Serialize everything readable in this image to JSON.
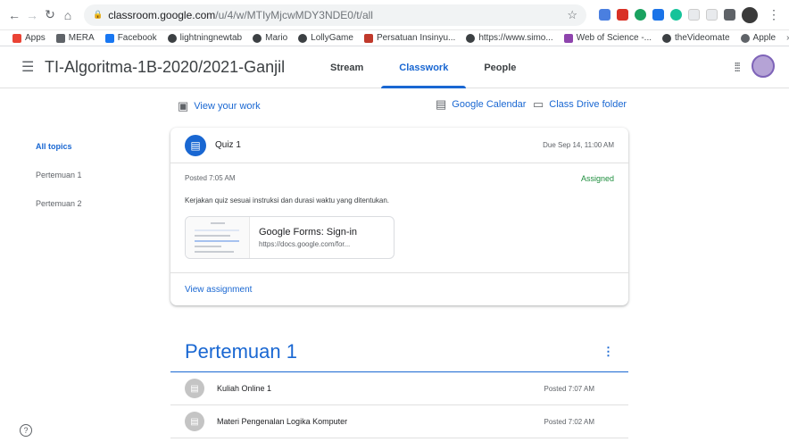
{
  "browser": {
    "url_host": "classroom.google.com",
    "url_path": "/u/4/w/MTIyMjcwMDY3NDE0/t/all"
  },
  "bookmarks": [
    {
      "label": "Apps",
      "color": "#ea4335"
    },
    {
      "label": "MERA",
      "color": "#5f6368"
    },
    {
      "label": "Facebook",
      "color": "#1877f2"
    },
    {
      "label": "lightningnewtab",
      "color": "#3c4043"
    },
    {
      "label": "Mario",
      "color": "#3c4043"
    },
    {
      "label": "LollyGame",
      "color": "#3c4043"
    },
    {
      "label": "Persatuan Insinyu...",
      "color": "#c0392b"
    },
    {
      "label": "https://www.simo...",
      "color": "#3c4043"
    },
    {
      "label": "Web of Science -...",
      "color": "#8e44ad"
    },
    {
      "label": "theVideomate",
      "color": "#3c4043"
    },
    {
      "label": "Apple",
      "color": "#5f6368"
    }
  ],
  "bookmarks_more": "»",
  "classroom": {
    "title": "TI-Algoritma-1B-2020/2021-Ganjil",
    "tabs": [
      "Stream",
      "Classwork",
      "People"
    ],
    "active_tab": "Classwork"
  },
  "toolbar": {
    "view_work": "View your work",
    "calendar": "Google Calendar",
    "drive": "Class Drive folder"
  },
  "topics": [
    "All topics",
    "Pertemuan 1",
    "Pertemuan 2"
  ],
  "quiz": {
    "title": "Quiz 1",
    "due": "Due Sep 14, 11:00 AM",
    "posted": "Posted 7:05 AM",
    "status": "Assigned",
    "instructions": "Kerjakan quiz sesuai instruksi dan durasi waktu yang ditentukan.",
    "attachment_title": "Google Forms: Sign-in",
    "attachment_url": "https://docs.google.com/for...",
    "view_link": "View assignment"
  },
  "section": {
    "title": "Pertemuan 1",
    "items": [
      {
        "title": "Kuliah Online 1",
        "posted": "Posted 7:07 AM"
      },
      {
        "title": "Materi Pengenalan Logika Komputer",
        "posted": "Posted 7:02 AM"
      }
    ]
  },
  "colors": {
    "accent": "#1967d2",
    "assigned": "#1e8e3e"
  }
}
